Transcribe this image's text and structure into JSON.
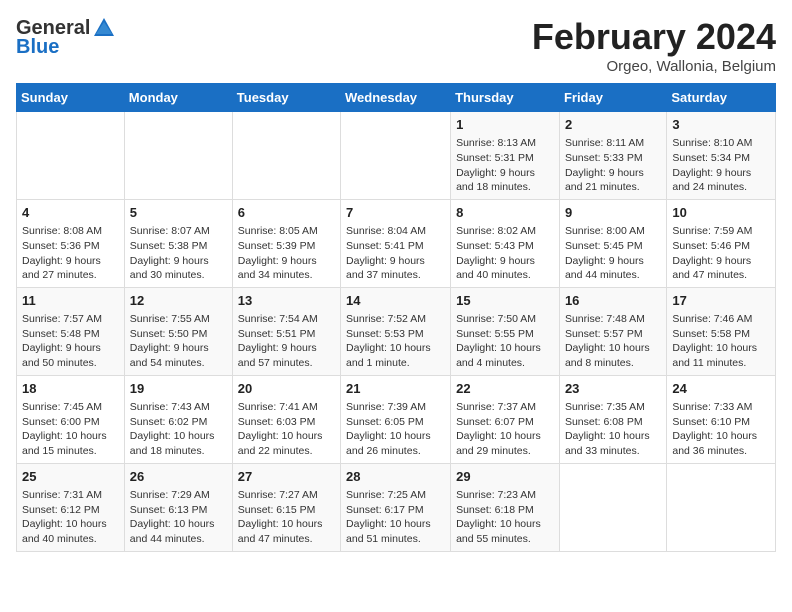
{
  "logo": {
    "general": "General",
    "blue": "Blue"
  },
  "title": "February 2024",
  "subtitle": "Orgeo, Wallonia, Belgium",
  "days_header": [
    "Sunday",
    "Monday",
    "Tuesday",
    "Wednesday",
    "Thursday",
    "Friday",
    "Saturday"
  ],
  "weeks": [
    [
      {
        "day": "",
        "info": ""
      },
      {
        "day": "",
        "info": ""
      },
      {
        "day": "",
        "info": ""
      },
      {
        "day": "",
        "info": ""
      },
      {
        "day": "1",
        "info": "Sunrise: 8:13 AM\nSunset: 5:31 PM\nDaylight: 9 hours and 18 minutes."
      },
      {
        "day": "2",
        "info": "Sunrise: 8:11 AM\nSunset: 5:33 PM\nDaylight: 9 hours and 21 minutes."
      },
      {
        "day": "3",
        "info": "Sunrise: 8:10 AM\nSunset: 5:34 PM\nDaylight: 9 hours and 24 minutes."
      }
    ],
    [
      {
        "day": "4",
        "info": "Sunrise: 8:08 AM\nSunset: 5:36 PM\nDaylight: 9 hours and 27 minutes."
      },
      {
        "day": "5",
        "info": "Sunrise: 8:07 AM\nSunset: 5:38 PM\nDaylight: 9 hours and 30 minutes."
      },
      {
        "day": "6",
        "info": "Sunrise: 8:05 AM\nSunset: 5:39 PM\nDaylight: 9 hours and 34 minutes."
      },
      {
        "day": "7",
        "info": "Sunrise: 8:04 AM\nSunset: 5:41 PM\nDaylight: 9 hours and 37 minutes."
      },
      {
        "day": "8",
        "info": "Sunrise: 8:02 AM\nSunset: 5:43 PM\nDaylight: 9 hours and 40 minutes."
      },
      {
        "day": "9",
        "info": "Sunrise: 8:00 AM\nSunset: 5:45 PM\nDaylight: 9 hours and 44 minutes."
      },
      {
        "day": "10",
        "info": "Sunrise: 7:59 AM\nSunset: 5:46 PM\nDaylight: 9 hours and 47 minutes."
      }
    ],
    [
      {
        "day": "11",
        "info": "Sunrise: 7:57 AM\nSunset: 5:48 PM\nDaylight: 9 hours and 50 minutes."
      },
      {
        "day": "12",
        "info": "Sunrise: 7:55 AM\nSunset: 5:50 PM\nDaylight: 9 hours and 54 minutes."
      },
      {
        "day": "13",
        "info": "Sunrise: 7:54 AM\nSunset: 5:51 PM\nDaylight: 9 hours and 57 minutes."
      },
      {
        "day": "14",
        "info": "Sunrise: 7:52 AM\nSunset: 5:53 PM\nDaylight: 10 hours and 1 minute."
      },
      {
        "day": "15",
        "info": "Sunrise: 7:50 AM\nSunset: 5:55 PM\nDaylight: 10 hours and 4 minutes."
      },
      {
        "day": "16",
        "info": "Sunrise: 7:48 AM\nSunset: 5:57 PM\nDaylight: 10 hours and 8 minutes."
      },
      {
        "day": "17",
        "info": "Sunrise: 7:46 AM\nSunset: 5:58 PM\nDaylight: 10 hours and 11 minutes."
      }
    ],
    [
      {
        "day": "18",
        "info": "Sunrise: 7:45 AM\nSunset: 6:00 PM\nDaylight: 10 hours and 15 minutes."
      },
      {
        "day": "19",
        "info": "Sunrise: 7:43 AM\nSunset: 6:02 PM\nDaylight: 10 hours and 18 minutes."
      },
      {
        "day": "20",
        "info": "Sunrise: 7:41 AM\nSunset: 6:03 PM\nDaylight: 10 hours and 22 minutes."
      },
      {
        "day": "21",
        "info": "Sunrise: 7:39 AM\nSunset: 6:05 PM\nDaylight: 10 hours and 26 minutes."
      },
      {
        "day": "22",
        "info": "Sunrise: 7:37 AM\nSunset: 6:07 PM\nDaylight: 10 hours and 29 minutes."
      },
      {
        "day": "23",
        "info": "Sunrise: 7:35 AM\nSunset: 6:08 PM\nDaylight: 10 hours and 33 minutes."
      },
      {
        "day": "24",
        "info": "Sunrise: 7:33 AM\nSunset: 6:10 PM\nDaylight: 10 hours and 36 minutes."
      }
    ],
    [
      {
        "day": "25",
        "info": "Sunrise: 7:31 AM\nSunset: 6:12 PM\nDaylight: 10 hours and 40 minutes."
      },
      {
        "day": "26",
        "info": "Sunrise: 7:29 AM\nSunset: 6:13 PM\nDaylight: 10 hours and 44 minutes."
      },
      {
        "day": "27",
        "info": "Sunrise: 7:27 AM\nSunset: 6:15 PM\nDaylight: 10 hours and 47 minutes."
      },
      {
        "day": "28",
        "info": "Sunrise: 7:25 AM\nSunset: 6:17 PM\nDaylight: 10 hours and 51 minutes."
      },
      {
        "day": "29",
        "info": "Sunrise: 7:23 AM\nSunset: 6:18 PM\nDaylight: 10 hours and 55 minutes."
      },
      {
        "day": "",
        "info": ""
      },
      {
        "day": "",
        "info": ""
      }
    ]
  ]
}
